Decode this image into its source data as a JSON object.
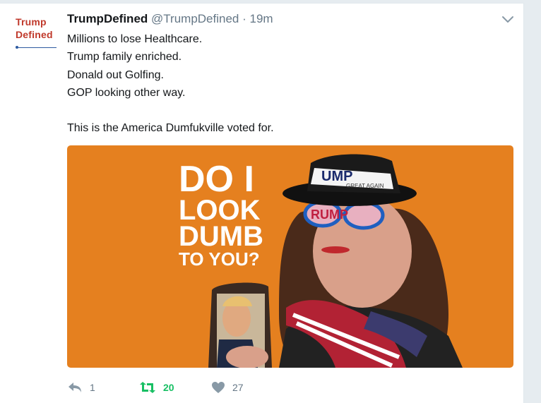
{
  "author": {
    "avatar_line1": "Trump",
    "avatar_line2": "Defined",
    "name": "TrumpDefined",
    "handle": "@TrumpDefined",
    "separator": "·",
    "time": "19m"
  },
  "tweet": {
    "lines": [
      "Millions to lose Healthcare.",
      "Trump family enriched.",
      "Donald out Golfing.",
      "GOP looking other way.",
      "",
      "This is the America Dumfukville voted for."
    ]
  },
  "media": {
    "headline": [
      "DO I",
      "LOOK",
      "DUMB",
      "TO YOU?"
    ],
    "hat_text": "UMP",
    "hat_band": "GREAT AGAIN",
    "glasses_text": "RUMP",
    "background_color": "#e5801f"
  },
  "actions": {
    "reply_count": "1",
    "retweet_count": "20",
    "like_count": "27",
    "reply_icon": "reply-icon",
    "retweet_icon": "retweet-icon",
    "like_icon": "heart-icon",
    "retweet_color": "#17bf63"
  }
}
